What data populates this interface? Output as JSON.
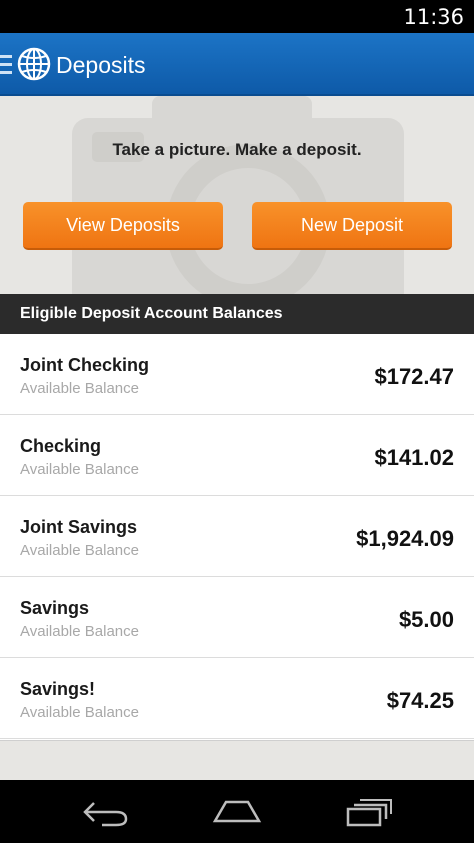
{
  "status_bar": {
    "time": "11:36"
  },
  "app_bar": {
    "title": "Deposits",
    "menu_icon": "hamburger-icon",
    "logo_icon": "globe-icon"
  },
  "hero": {
    "tagline": "Take a picture. Make a deposit.",
    "view_button": "View Deposits",
    "new_button": "New Deposit",
    "background_icon": "camera-icon"
  },
  "section": {
    "title": "Eligible Deposit Account Balances"
  },
  "accounts": [
    {
      "name": "Joint Checking",
      "subtitle": "Available Balance",
      "balance": "$172.47"
    },
    {
      "name": "Checking",
      "subtitle": "Available Balance",
      "balance": "$141.02"
    },
    {
      "name": "Joint Savings",
      "subtitle": "Available Balance",
      "balance": "$1,924.09"
    },
    {
      "name": "Savings",
      "subtitle": "Available Balance",
      "balance": "$5.00"
    },
    {
      "name": "Savings!",
      "subtitle": "Available Balance",
      "balance": "$74.25"
    }
  ],
  "colors": {
    "app_bar": "#1565b5",
    "button": "#f28a1e",
    "section_header": "#2b2b2b"
  },
  "nav": {
    "back_icon": "back-icon",
    "home_icon": "home-icon",
    "recent_icon": "recent-apps-icon"
  }
}
